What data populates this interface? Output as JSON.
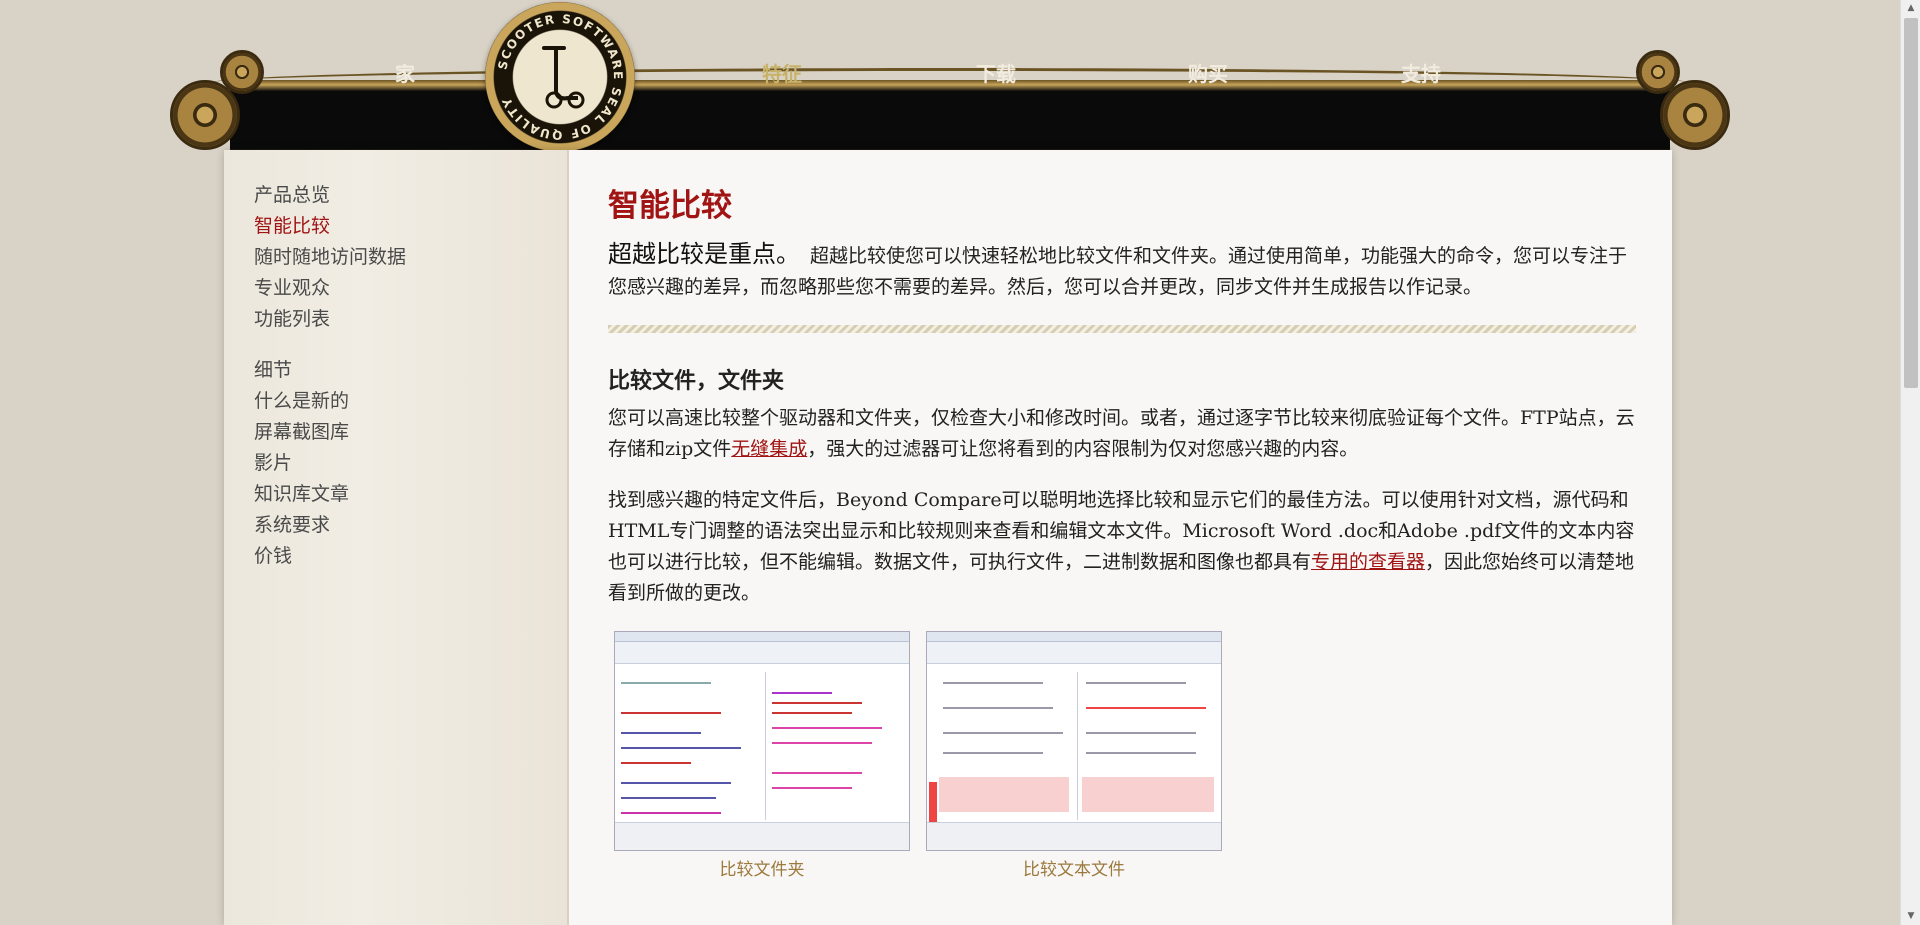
{
  "nav": {
    "items": [
      {
        "label": "家",
        "active": false
      },
      {
        "label": "特征",
        "active": true
      },
      {
        "label": "下载",
        "active": false
      },
      {
        "label": "购买",
        "active": false
      },
      {
        "label": "支持",
        "active": false
      }
    ],
    "seal_text": "SCOOTER SOFTWARE SEAL OF QUALITY"
  },
  "sidebar": {
    "group1": [
      {
        "label": "产品总览",
        "active": false
      },
      {
        "label": "智能比较",
        "active": true
      },
      {
        "label": "随时随地访问数据",
        "active": false
      },
      {
        "label": "专业观众",
        "active": false
      },
      {
        "label": "功能列表",
        "active": false
      }
    ],
    "group2": [
      {
        "label": "细节",
        "active": false
      },
      {
        "label": "什么是新的",
        "active": false
      },
      {
        "label": "屏幕截图库",
        "active": false
      },
      {
        "label": "影片",
        "active": false
      },
      {
        "label": "知识库文章",
        "active": false
      },
      {
        "label": "系统要求",
        "active": false
      },
      {
        "label": "价钱",
        "active": false
      }
    ]
  },
  "content": {
    "title": "智能比较",
    "lead_strong": "超越比较是重点。",
    "lead_text": "超越比较使您可以快速轻松地比较文件和文件夹。通过使用简单，功能强大的命令，您可以专注于您感兴趣的差异，而忽略那些您不需要的差异。然后，您可以合并更改，同步文件并生成报告以作记录。",
    "section1_title": "比较文件，文件夹",
    "p1_before": "您可以高速比较整个驱动器和文件夹，仅检查大小和修改时间。或者，通过逐字节比较来彻底验证每个文件。FTP站点，云存储和zip文件",
    "p1_link": "无缝集成",
    "p1_after": "，强大的过滤器可让您将看到的内容限制为仅对您感兴趣的内容。",
    "p2_before": "找到感兴趣的特定文件后，Beyond Compare可以聪明地选择比较和显示它们的最佳方法。可以使用针对文档，源代码和HTML专门调整的语法突出显示和比较规则来查看和编辑文本文件。Microsoft Word .doc和Adobe .pdf文件的文本内容也可以进行比较，但不能编辑。数据文件，可执行文件，二进制数据和图像也都具有",
    "p2_link": "专用的查看器",
    "p2_after": "，因此您始终可以清楚地看到所做的更改。",
    "thumbnails": [
      {
        "caption": "比较文件夹"
      },
      {
        "caption": "比较文本文件"
      }
    ]
  },
  "colors": {
    "accent": "#a11414",
    "caption": "#9c7a3e",
    "nav_active": "#c8b26a"
  }
}
